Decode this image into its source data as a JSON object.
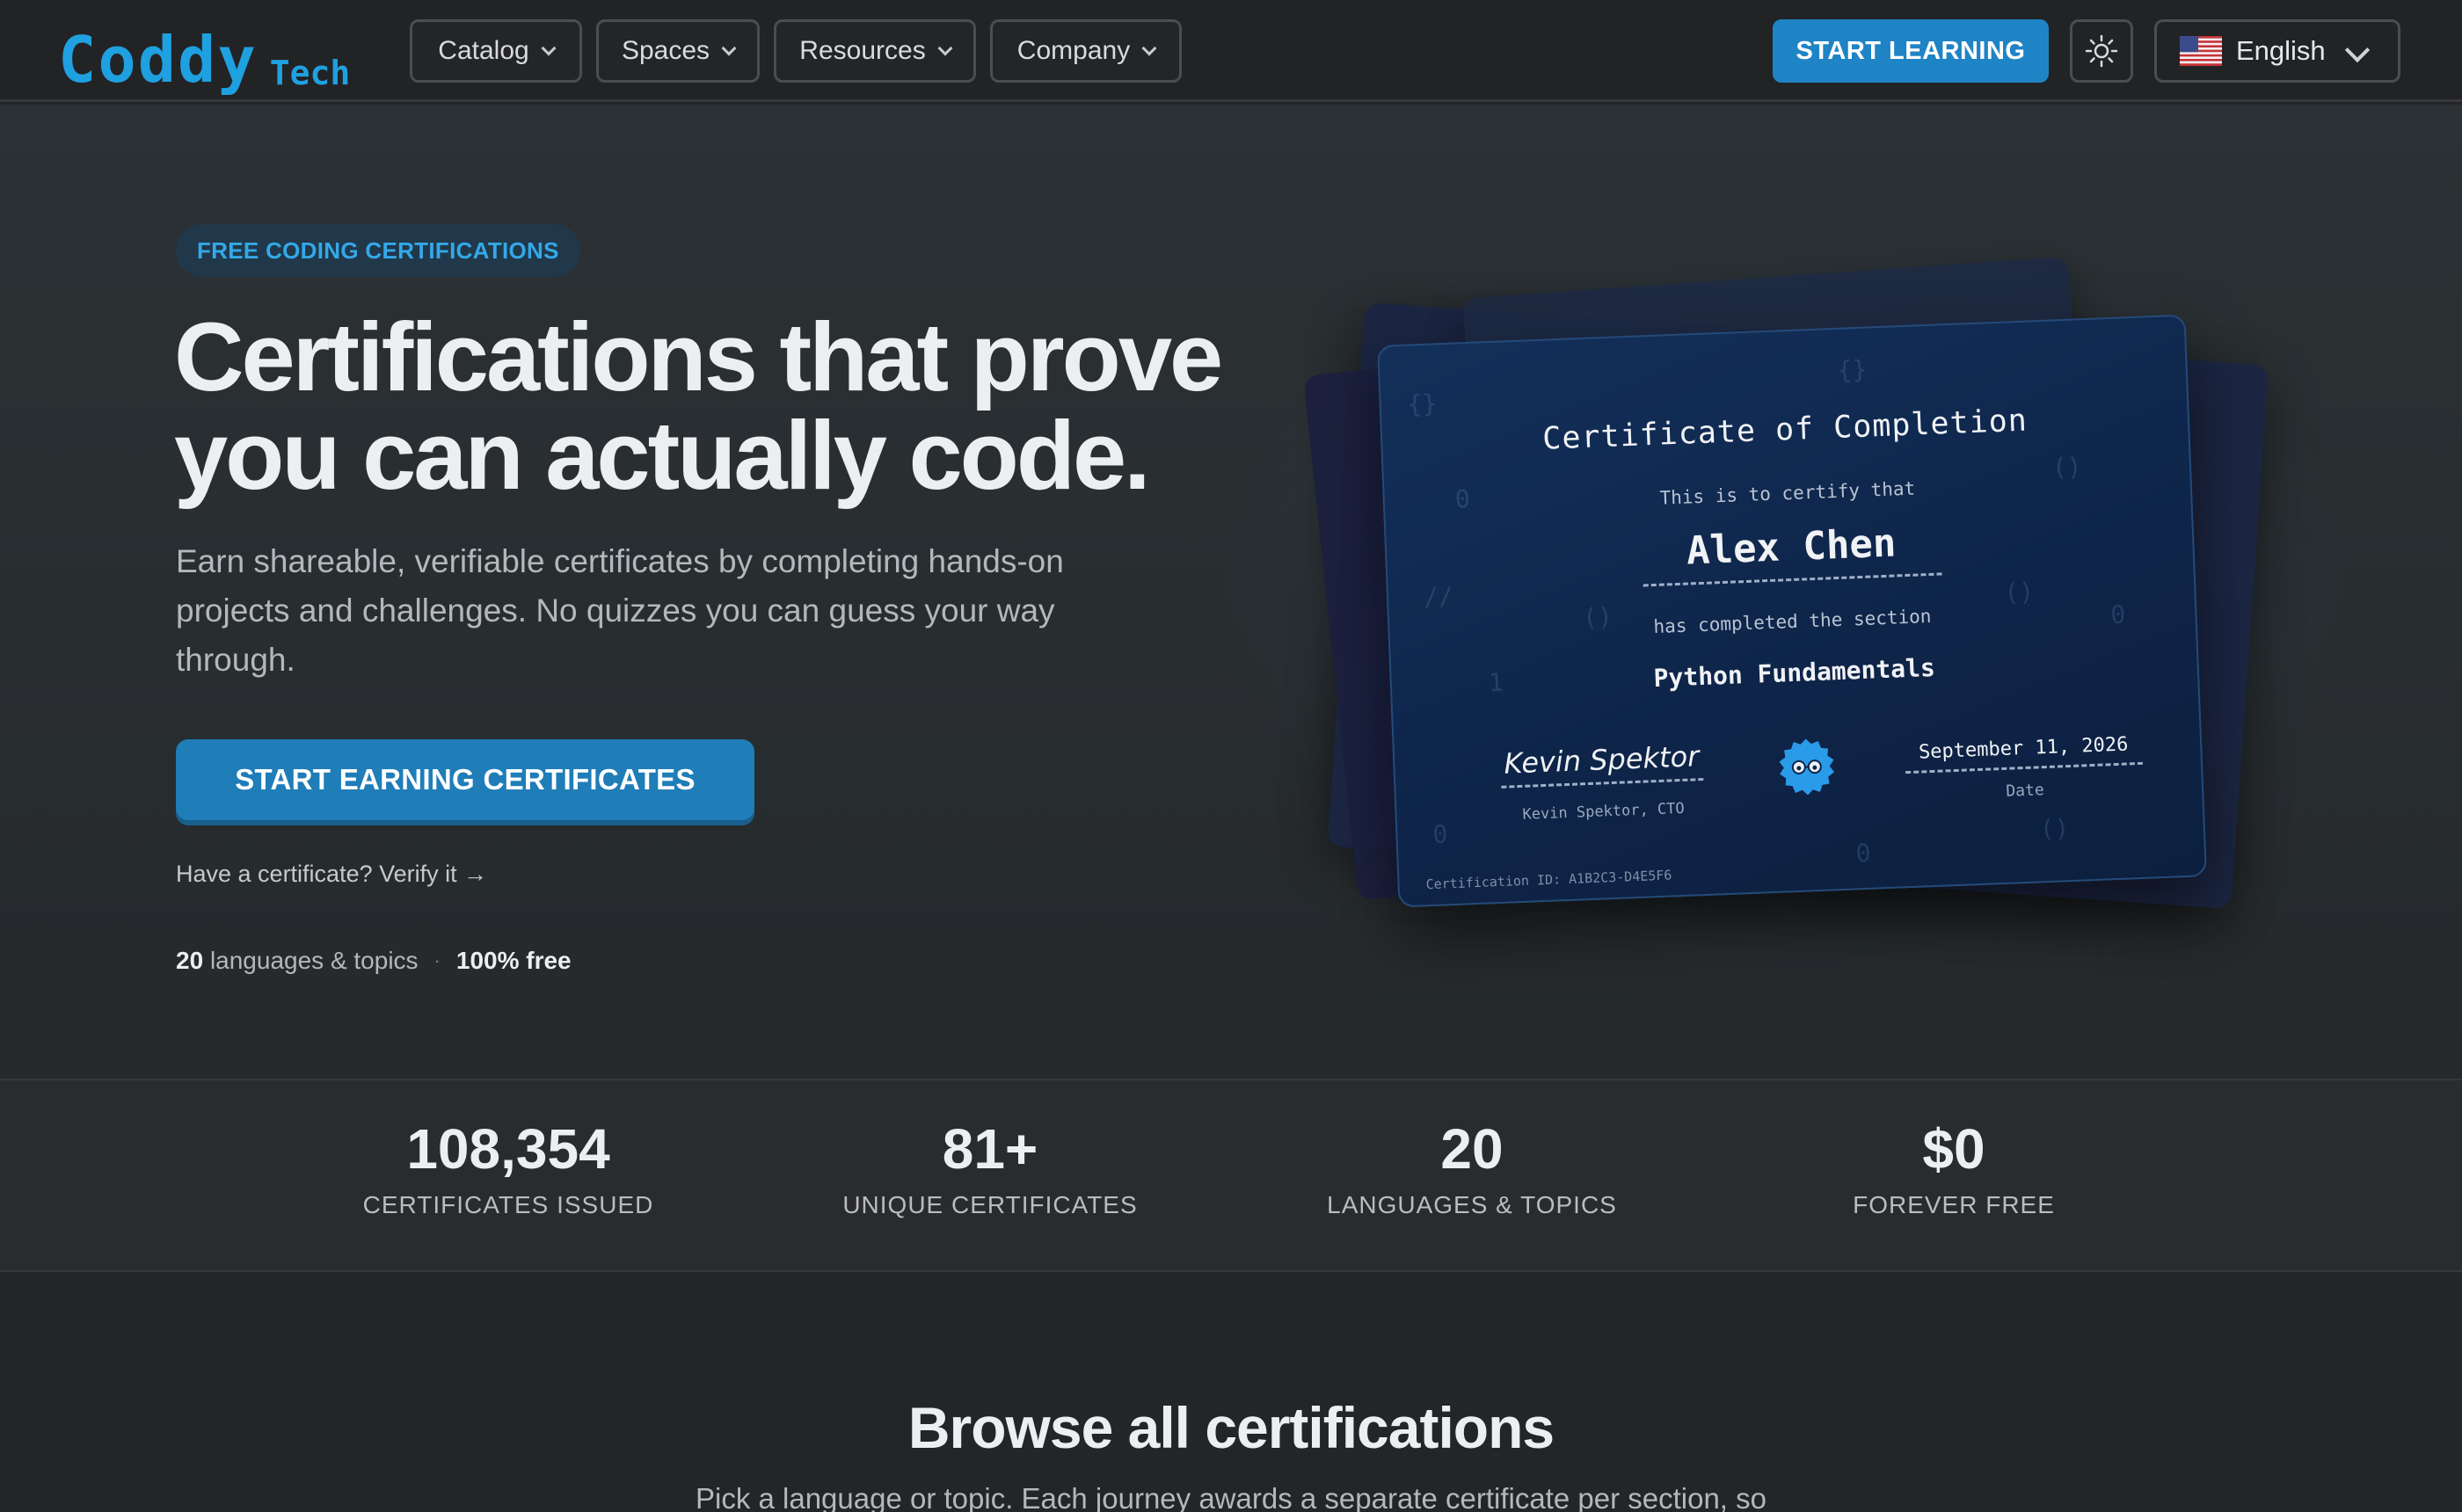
{
  "brand": {
    "name": "Coddy",
    "suffix": "Tech",
    "accent": "#1fa0e0"
  },
  "nav": {
    "menus": [
      {
        "label": "Catalog"
      },
      {
        "label": "Spaces"
      },
      {
        "label": "Resources"
      },
      {
        "label": "Company"
      }
    ],
    "cta_label": "START LEARNING",
    "theme_icon": "sun-icon",
    "language": {
      "label": "English",
      "flag_icon": "us-flag-icon"
    }
  },
  "hero": {
    "badge": "FREE CODING CERTIFICATIONS",
    "headline": "Certifications that prove you can actually code.",
    "subtext": "Earn shareable, verifiable certificates by completing hands-on projects and challenges. No quizzes you can guess your way through.",
    "cta_label": "START EARNING CERTIFICATES",
    "verify_link": "Have a certificate? Verify it →",
    "meta": {
      "count": "20",
      "count_label": "languages & topics",
      "separator": "·",
      "free_label": "100% free"
    }
  },
  "certificate": {
    "title": "Certificate of Completion",
    "line1": "This is to certify that",
    "name": "Alex Chen",
    "line2": "has completed the section",
    "course": "Python Fundamentals",
    "signature": "Kevin Spektor",
    "signature_caption": "Kevin Spektor, CTO",
    "date": "September 11, 2026",
    "date_caption": "Date",
    "cert_id": "Certification ID: A1B2C3-D4E5F6"
  },
  "stats": [
    {
      "value": "108,354",
      "label": "CERTIFICATES ISSUED"
    },
    {
      "value": "81+",
      "label": "UNIQUE CERTIFICATES"
    },
    {
      "value": "20",
      "label": "LANGUAGES & TOPICS"
    },
    {
      "value": "$0",
      "label": "FOREVER FREE"
    }
  ],
  "browse": {
    "title": "Browse all certifications",
    "subtitle": "Pick a language or topic. Each journey awards a separate certificate per section, so"
  }
}
